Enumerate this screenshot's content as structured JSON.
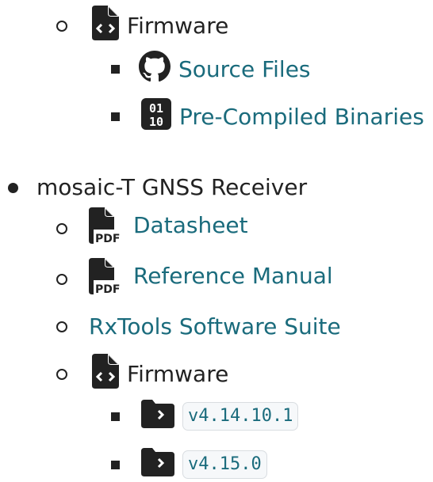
{
  "tree": {
    "fw1": {
      "label": "Firmware",
      "icon": "file-code-icon"
    },
    "source_files": {
      "label": "Source Files",
      "icon": "github-icon"
    },
    "binaries": {
      "label": "Pre-Compiled Binaries",
      "icon": "binary-icon"
    },
    "receiver": {
      "label": "mosaic-T GNSS Receiver"
    },
    "datasheet": {
      "label": "Datasheet",
      "icon": "pdf-file-icon"
    },
    "reference_manual": {
      "label": "Reference Manual",
      "icon": "pdf-file-icon"
    },
    "rxtools": {
      "label": "RxTools Software Suite"
    },
    "fw2": {
      "label": "Firmware",
      "icon": "file-code-icon"
    },
    "versions": [
      "v4.14.10.1",
      "v4.15.0"
    ]
  },
  "colors": {
    "link": "#1a6b7c",
    "text": "#222222",
    "code_bg": "#f6f8fa",
    "code_border": "#d9dde1"
  }
}
